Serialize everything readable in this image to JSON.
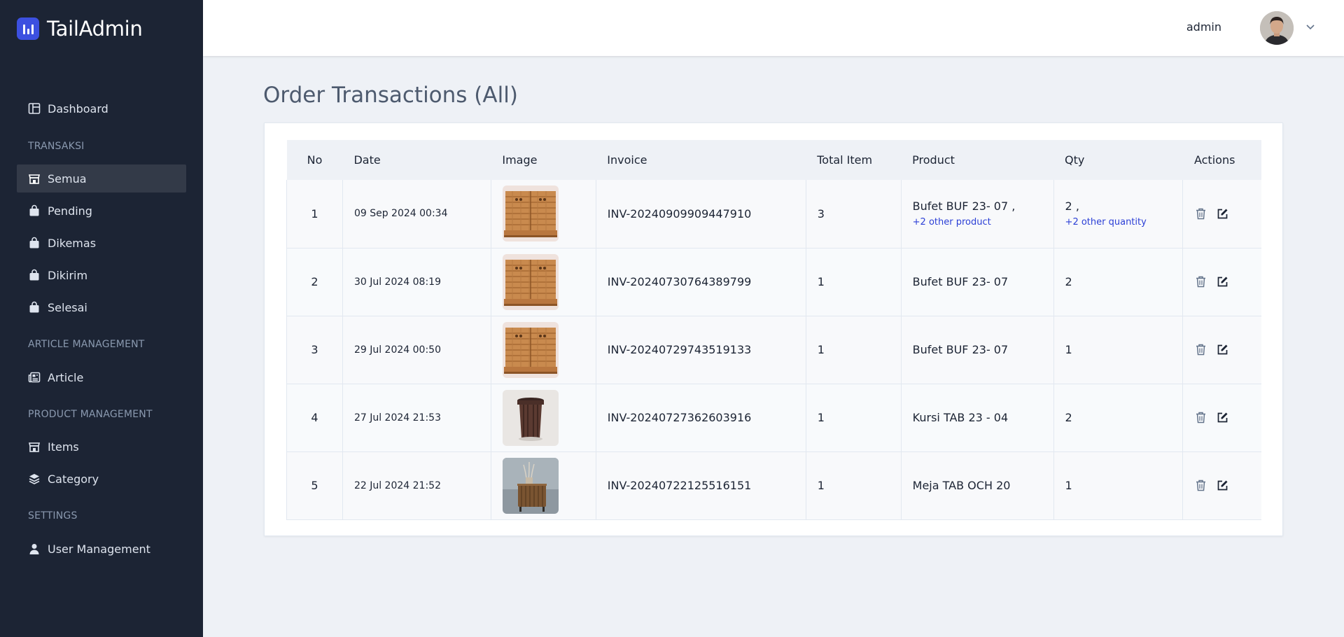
{
  "app": {
    "name": "TailAdmin"
  },
  "header": {
    "user_name": "admin"
  },
  "sidebar": {
    "dashboard": "Dashboard",
    "sections": {
      "transaksi": "TRANSAKSI",
      "article": "ARTICLE MANAGEMENT",
      "product": "PRODUCT MANAGEMENT",
      "settings": "SETTINGS"
    },
    "transaksi_items": [
      "Semua",
      "Pending",
      "Dikemas",
      "Dikirim",
      "Selesai"
    ],
    "article_items": [
      "Article"
    ],
    "product_items": [
      "Items",
      "Category"
    ],
    "settings_items": [
      "User Management"
    ],
    "active": "Semua"
  },
  "page": {
    "title": "Order Transactions (All)"
  },
  "table": {
    "headers": {
      "no": "No",
      "date": "Date",
      "image": "Image",
      "invoice": "Invoice",
      "total_item": "Total Item",
      "product": "Product",
      "qty": "Qty",
      "actions": "Actions"
    },
    "rows": [
      {
        "no": "1",
        "date": "09 Sep 2024 00:34",
        "image": "cabinet",
        "invoice": "INV-20240909909447910",
        "total_item": "3",
        "product": "Bufet BUF 23- 07 ,",
        "product_more": "+2 other product",
        "qty": "2 ,",
        "qty_more": "+2 other quantity"
      },
      {
        "no": "2",
        "date": "30 Jul 2024 08:19",
        "image": "cabinet",
        "invoice": "INV-20240730764389799",
        "total_item": "1",
        "product": "Bufet BUF 23- 07",
        "product_more": "",
        "qty": "2",
        "qty_more": ""
      },
      {
        "no": "3",
        "date": "29 Jul 2024 00:50",
        "image": "cabinet",
        "invoice": "INV-20240729743519133",
        "total_item": "1",
        "product": "Bufet BUF 23- 07",
        "product_more": "",
        "qty": "1",
        "qty_more": ""
      },
      {
        "no": "4",
        "date": "27 Jul 2024 21:53",
        "image": "stool",
        "invoice": "INV-20240727362603916",
        "total_item": "1",
        "product": "Kursi TAB 23 - 04",
        "product_more": "",
        "qty": "2",
        "qty_more": ""
      },
      {
        "no": "5",
        "date": "22 Jul 2024 21:52",
        "image": "side-table",
        "invoice": "INV-20240722125516151",
        "total_item": "1",
        "product": "Meja TAB OCH 20",
        "product_more": "",
        "qty": "1",
        "qty_more": ""
      }
    ]
  },
  "icons": {
    "row_delete": "trash-icon",
    "row_edit": "edit-icon"
  },
  "colors": {
    "sidebar_bg": "#1c2434",
    "active_item_bg": "#333a48",
    "accent": "#3c50e0",
    "link": "#2b3fd6"
  }
}
